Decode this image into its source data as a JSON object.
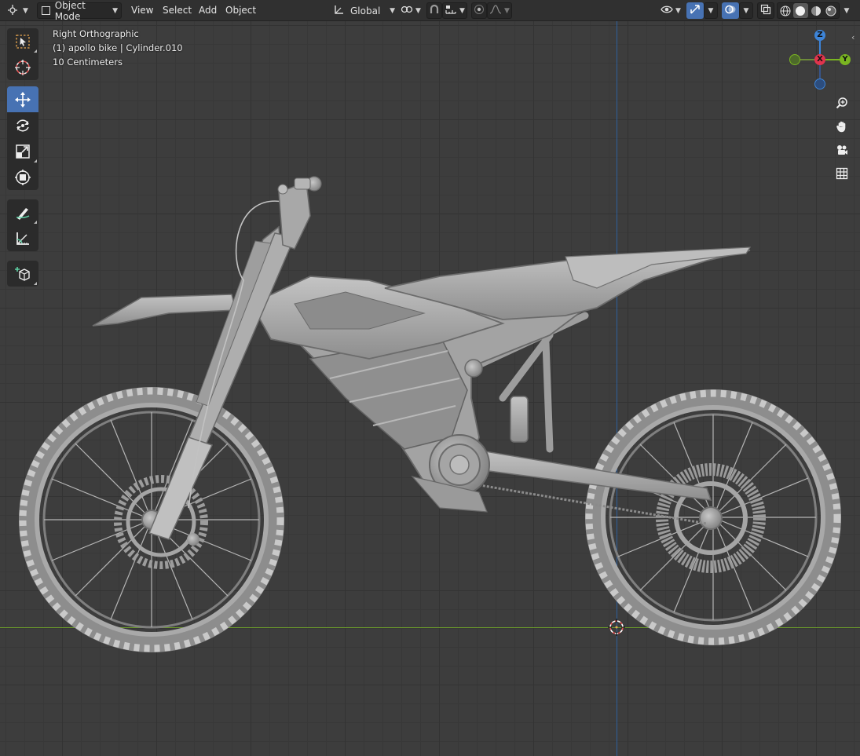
{
  "header": {
    "editor_type_icon": "viewport-icon",
    "mode": {
      "label": "Object Mode",
      "icon": "object-mode-icon"
    },
    "menus": [
      "View",
      "Select",
      "Add",
      "Object"
    ],
    "transform_orientation": {
      "label": "Global",
      "icon": "orientation-icon"
    },
    "pivot_icon": "pivot-point-icon",
    "snap_icon": "magnet-icon",
    "snap_target_icon": "snap-increment-icon",
    "proportional_icon": "proportional-edit-icon",
    "falloff_icon": "falloff-curve-icon",
    "visibility_icon": "eye-icon",
    "gizmo_icon": "gizmo-toggle-icon",
    "overlay_icon": "overlays-icon",
    "xray_icon": "xray-icon",
    "shading_modes": [
      "wireframe",
      "solid",
      "material-preview",
      "rendered"
    ],
    "active_shading": "solid",
    "sidebar_toggle_icon": "sidebar-toggle-icon"
  },
  "viewport": {
    "view_name": "Right Orthographic",
    "object_info": "(1) apollo bike | Cylinder.010",
    "grid_scale": "10 Centimeters",
    "subject": "apollo bike"
  },
  "toolbar": {
    "tools": [
      {
        "name": "select-box",
        "icon": "select-box-icon",
        "active": false
      },
      {
        "name": "cursor",
        "icon": "cursor-icon",
        "active": false
      },
      {
        "name": "move",
        "icon": "move-icon",
        "active": true
      },
      {
        "name": "rotate",
        "icon": "rotate-icon",
        "active": false
      },
      {
        "name": "scale",
        "icon": "scale-icon",
        "active": false
      },
      {
        "name": "transform",
        "icon": "transform-icon",
        "active": false
      },
      {
        "name": "annotate",
        "icon": "annotate-icon",
        "active": false
      },
      {
        "name": "measure",
        "icon": "measure-icon",
        "active": false
      },
      {
        "name": "add-cube",
        "icon": "add-cube-icon",
        "active": false
      }
    ]
  },
  "navigation": {
    "gizmo_axes": {
      "z": "Z",
      "x": "X",
      "y": "Y"
    },
    "buttons": [
      "zoom-icon",
      "hand-pan-icon",
      "camera-icon",
      "grid-toggle-icon"
    ]
  },
  "colors": {
    "accent": "#4772b3",
    "axis_x_red": "#e0344d",
    "axis_y_green": "#7ab521",
    "axis_z_blue": "#3d84d8",
    "ground_line": "#6a9a2b",
    "vertical_line": "#2e5f9c",
    "viewport_bg": "#3d3d3d",
    "header_bg": "#303030",
    "model": "#a8a8a8"
  }
}
